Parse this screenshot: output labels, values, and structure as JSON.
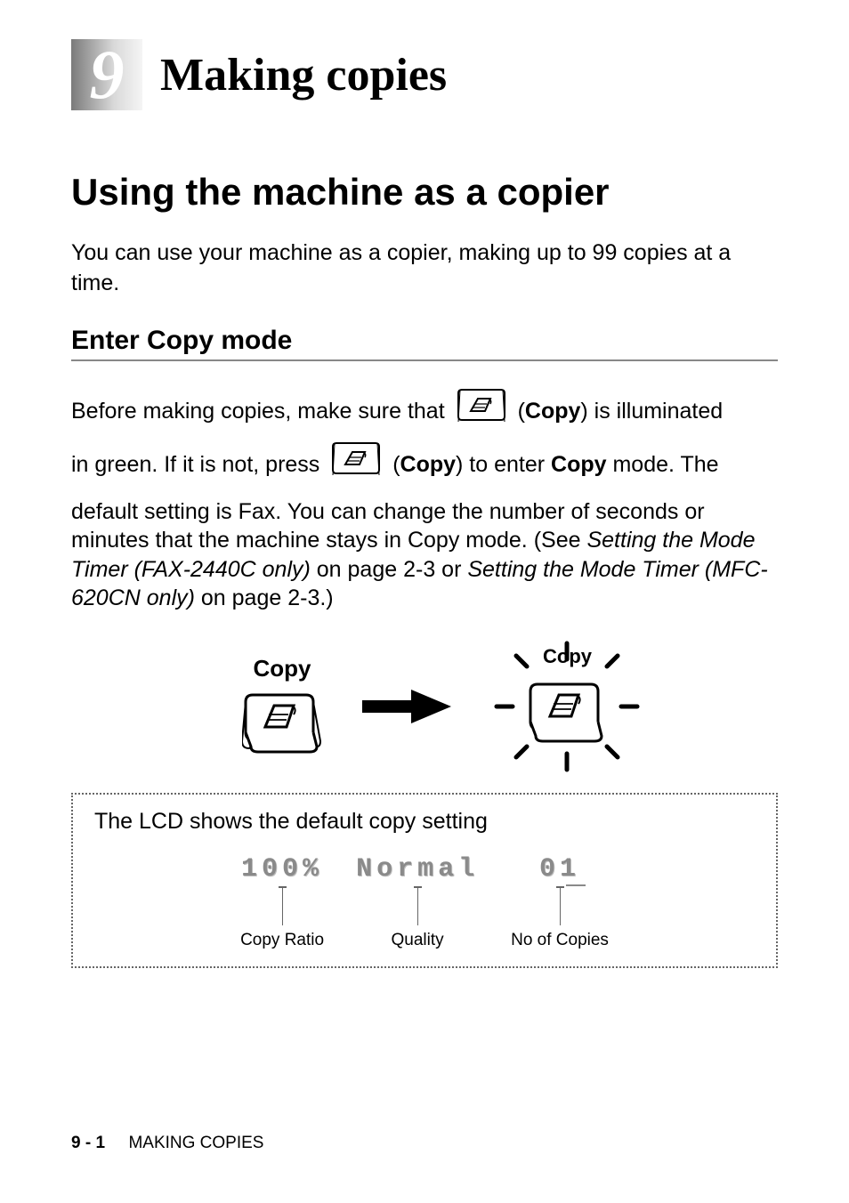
{
  "chapter": {
    "number": "9",
    "title": "Making copies"
  },
  "section1": {
    "heading": "Using the machine as a copier",
    "body": "You can use your machine as a copier, making up to 99 copies at a time."
  },
  "section2": {
    "heading": "Enter Copy mode",
    "para1_pre": "Before making copies, make sure that ",
    "para1_label": "Copy",
    "para1_post": ") is illuminated",
    "para2_pre": "in green. If it is not, press ",
    "para2_label": "Copy",
    "para2_mid": ") to enter ",
    "para2_mode": "Copy",
    "para2_post": " mode. The",
    "para3_a": "default setting is Fax. You can change the number of seconds or minutes that the machine stays in Copy mode. (See ",
    "para3_ref1": "Setting the Mode Timer (FAX-2440C only)",
    "para3_b": " on page 2-3 or ",
    "para3_ref2": "Setting the Mode Timer (MFC-620CN only)",
    "para3_c": " on page 2-3.)"
  },
  "illustration": {
    "left_label": "Copy",
    "right_label": "Copy"
  },
  "lcd": {
    "title": "The LCD shows the default copy setting",
    "ratio_value": "100%",
    "quality_value": "Normal",
    "copies_value": "01",
    "ratio_label": "Copy Ratio",
    "quality_label": "Quality",
    "copies_label": "No of Copies"
  },
  "footer": {
    "page": "9 - 1",
    "title": "MAKING COPIES"
  }
}
